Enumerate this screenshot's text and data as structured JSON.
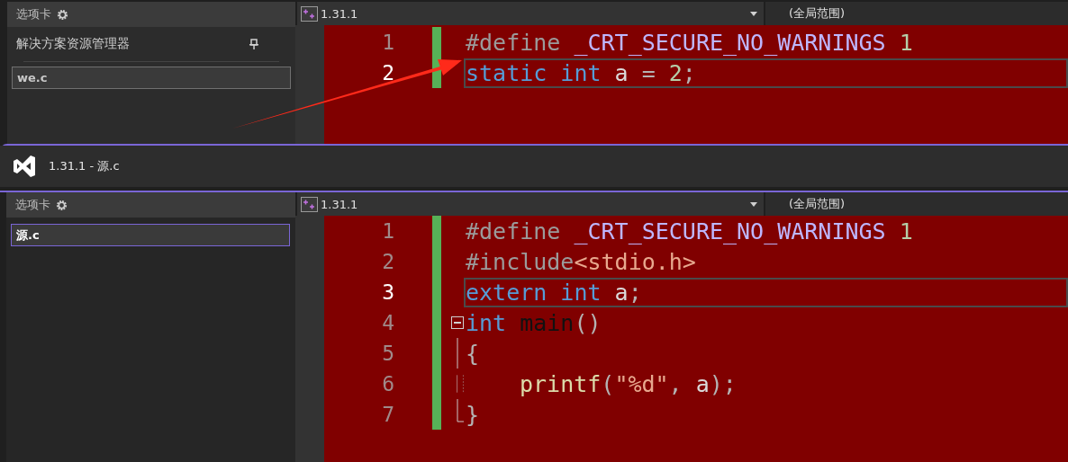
{
  "windows": [
    {
      "active": false,
      "tool_tab": {
        "label": "选项卡"
      },
      "panel_title": "解决方案资源管理器",
      "search": {
        "value": "we.c",
        "focused": false
      },
      "nav": {
        "project": "1.31.1",
        "scope": "(全局范围)"
      },
      "lines": [
        {
          "number": "1",
          "current": false,
          "changed": true,
          "kind": "plain",
          "indented": false,
          "tokens": [
            {
              "text": "#define ",
              "kind": "directive"
            },
            {
              "text": "_CRT_SECURE_NO_WARNINGS ",
              "kind": "macro"
            },
            {
              "text": "1",
              "kind": "number"
            }
          ]
        },
        {
          "number": "2",
          "current": true,
          "changed": true,
          "kind": "plain",
          "indented": false,
          "tokens": [
            {
              "text": "static ",
              "kind": "keyword"
            },
            {
              "text": "int ",
              "kind": "keyword"
            },
            {
              "text": "a ",
              "kind": "ident"
            },
            {
              "text": "= ",
              "kind": "punct"
            },
            {
              "text": "2",
              "kind": "number"
            },
            {
              "text": ";",
              "kind": "punct"
            }
          ]
        }
      ]
    },
    {
      "title": "1.31.1 - 源.c",
      "active": true,
      "tool_tab": {
        "label": "选项卡"
      },
      "search": {
        "value": "源.c",
        "focused": true
      },
      "nav": {
        "project": "1.31.1",
        "scope": "(全局范围)"
      },
      "lines": [
        {
          "number": "1",
          "current": false,
          "changed": true,
          "kind": "plain",
          "indented": false,
          "tokens": [
            {
              "text": "#define ",
              "kind": "directive"
            },
            {
              "text": "_CRT_SECURE_NO_WARNINGS ",
              "kind": "macro"
            },
            {
              "text": "1",
              "kind": "number"
            }
          ]
        },
        {
          "number": "2",
          "current": false,
          "changed": true,
          "kind": "plain",
          "indented": false,
          "tokens": [
            {
              "text": "#include",
              "kind": "directive"
            },
            {
              "text": "<stdio.h>",
              "kind": "string"
            }
          ]
        },
        {
          "number": "3",
          "current": true,
          "changed": true,
          "kind": "plain",
          "indented": false,
          "tokens": [
            {
              "text": "extern ",
              "kind": "keyword"
            },
            {
              "text": "int ",
              "kind": "keyword"
            },
            {
              "text": "a",
              "kind": "ident"
            },
            {
              "text": ";",
              "kind": "punct"
            }
          ]
        },
        {
          "number": "4",
          "current": false,
          "changed": true,
          "kind": "foldstart",
          "indented": false,
          "tokens": [
            {
              "text": "int ",
              "kind": "keyword"
            },
            {
              "text": "main",
              "kind": "function_def"
            },
            {
              "text": "()",
              "kind": "punct"
            }
          ]
        },
        {
          "number": "5",
          "current": false,
          "changed": true,
          "kind": "foldbody",
          "indented": false,
          "tokens": [
            {
              "text": "{",
              "kind": "punct"
            }
          ]
        },
        {
          "number": "6",
          "current": false,
          "changed": true,
          "kind": "foldguide",
          "indented": true,
          "tokens": [
            {
              "text": "printf",
              "kind": "function"
            },
            {
              "text": "(",
              "kind": "punct"
            },
            {
              "text": "\"%d\"",
              "kind": "string"
            },
            {
              "text": ", ",
              "kind": "punct"
            },
            {
              "text": "a",
              "kind": "ident"
            },
            {
              "text": ");",
              "kind": "punct"
            }
          ]
        },
        {
          "number": "7",
          "current": false,
          "changed": true,
          "kind": "foldend",
          "indented": false,
          "tokens": [
            {
              "text": "}",
              "kind": "punct"
            }
          ]
        }
      ]
    }
  ]
}
